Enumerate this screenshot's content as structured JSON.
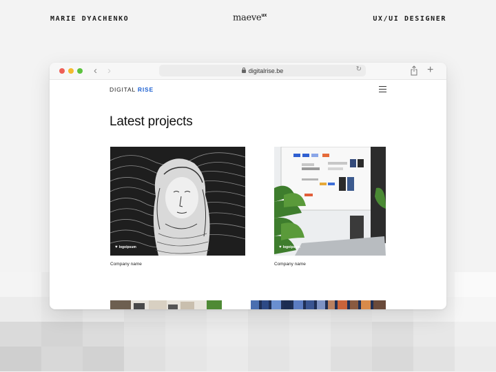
{
  "header": {
    "designer_name": "MARIE DYACHENKO",
    "brand": "maeve",
    "brand_sup": "ux",
    "role": "UX/UI DESIGNER"
  },
  "browser": {
    "url": "digitalrise.be"
  },
  "site": {
    "logo_main": "DIGITAL",
    "logo_accent": "RISE",
    "accent_color": "#1b5fd1",
    "heading": "Latest projects",
    "projects": [
      {
        "caption": "Company name",
        "watermark": "logoipsum"
      },
      {
        "caption": "Company name",
        "watermark": "logoipsum"
      }
    ]
  },
  "icons": {
    "back": "chevron-left-icon",
    "forward": "chevron-right-icon",
    "lock": "lock-icon",
    "reload": "reload-icon",
    "share": "share-icon",
    "new_tab": "plus-icon",
    "menu": "hamburger-menu-icon"
  }
}
